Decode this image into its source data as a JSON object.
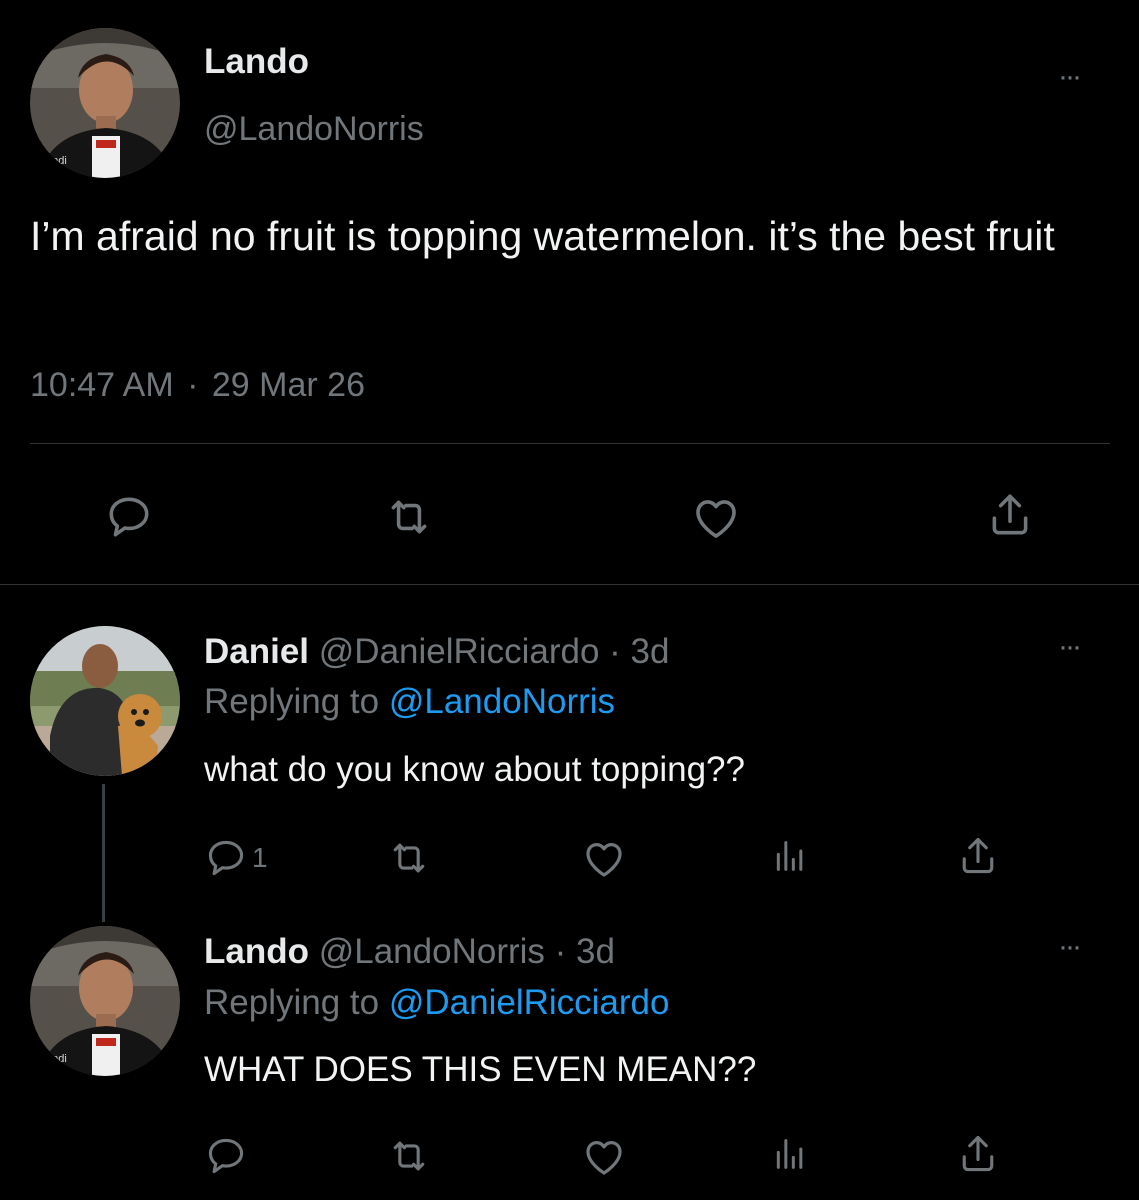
{
  "main_tweet": {
    "name": "Lando",
    "handle": "@LandoNorris",
    "text": "I’m afraid no fruit is topping watermelon. it’s the best fruit",
    "time": "10:47 AM",
    "separator": "·",
    "date": "29 Mar 26",
    "more_label": "···"
  },
  "replies": [
    {
      "name": "Daniel",
      "handle": "@DanielRicciardo",
      "age": "· 3d",
      "replying_prefix": "Replying to",
      "replying_to": "@LandoNorris",
      "text": "what do you know about topping??",
      "reply_count": "1",
      "more_label": "···"
    },
    {
      "name": "Lando",
      "handle": "@LandoNorris",
      "age": "· 3d",
      "replying_prefix": "Replying to",
      "replying_to": "@DanielRicciardo",
      "text": "WHAT DOES THIS EVEN MEAN??",
      "more_label": "···"
    }
  ],
  "icons": {
    "reply": "reply-icon",
    "retweet": "retweet-icon",
    "like": "heart-icon",
    "views": "analytics-icon",
    "share": "share-icon",
    "more": "more-icon"
  },
  "colors": {
    "background": "#000000",
    "text": "#e7e9ea",
    "muted": "#71767b",
    "link": "#1d9bf0",
    "divider": "#2f3336"
  }
}
